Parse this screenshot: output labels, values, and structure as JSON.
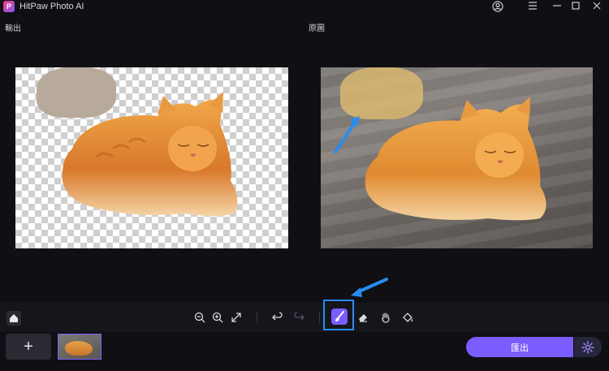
{
  "app": {
    "logo_letter": "P",
    "title": "HitPaw Photo AI"
  },
  "window_controls": {
    "account_icon": "user-circle-icon",
    "menu_icon": "hamburger-icon",
    "minimize_icon": "minimize-icon",
    "maximize_icon": "maximize-icon",
    "close_icon": "close-icon"
  },
  "panels": {
    "output_label": "輸出",
    "original_label": "原圖"
  },
  "toolbar": {
    "home_icon": "home-icon",
    "zoom_out_icon": "zoom-out-icon",
    "zoom_in_icon": "zoom-in-icon",
    "fit_icon": "expand-icon",
    "undo_icon": "undo-icon",
    "redo_icon": "redo-icon",
    "brush_icon": "brush-icon",
    "eraser_icon": "eraser-icon",
    "hand_icon": "hand-icon",
    "fill_icon": "paint-bucket-icon",
    "active_tool": "brush"
  },
  "bottom": {
    "add_label": "+",
    "export_label": "匯出",
    "settings_icon": "gear-icon"
  },
  "colors": {
    "accent": "#7b5cff",
    "highlight": "#2a8cf0",
    "background": "#0f0f14"
  }
}
